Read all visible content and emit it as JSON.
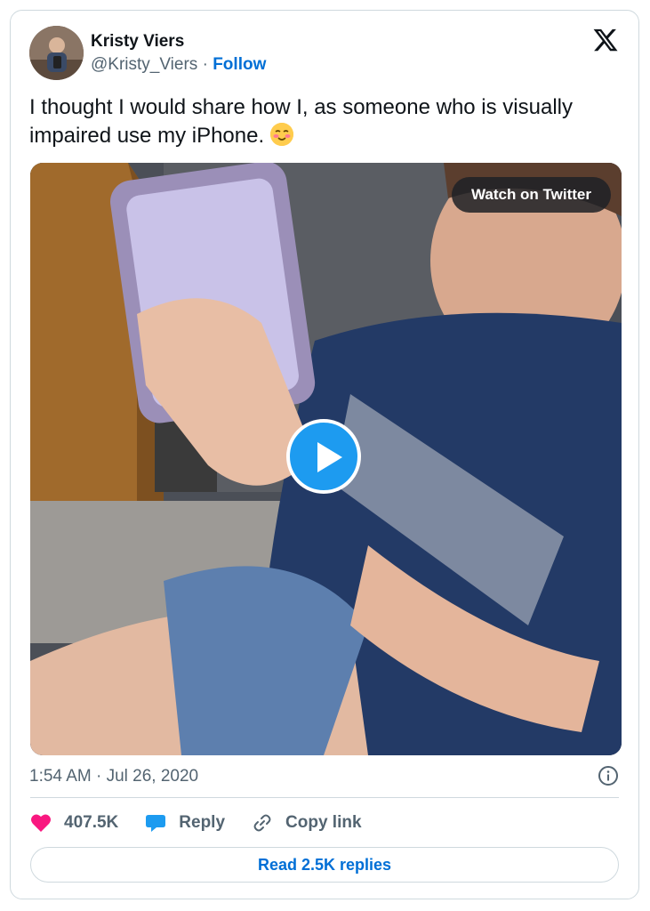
{
  "author": {
    "name": "Kristy Viers",
    "handle": "@Kristy_Viers",
    "separator": "·",
    "follow_label": "Follow"
  },
  "tweet": {
    "text": "I thought I would share how I, as someone who is visually impaired use my iPhone."
  },
  "media": {
    "watch_label": "Watch on Twitter",
    "play_icon": "play-icon"
  },
  "meta": {
    "timestamp": "1:54 AM · Jul 26, 2020"
  },
  "actions": {
    "like_count": "407.5K",
    "reply_label": "Reply",
    "copy_label": "Copy link"
  },
  "footer": {
    "read_replies_label": "Read 2.5K replies"
  },
  "colors": {
    "accent": "#1d9bf0",
    "link": "#006fd6",
    "like": "#f91880",
    "secondary_text": "#536471"
  }
}
